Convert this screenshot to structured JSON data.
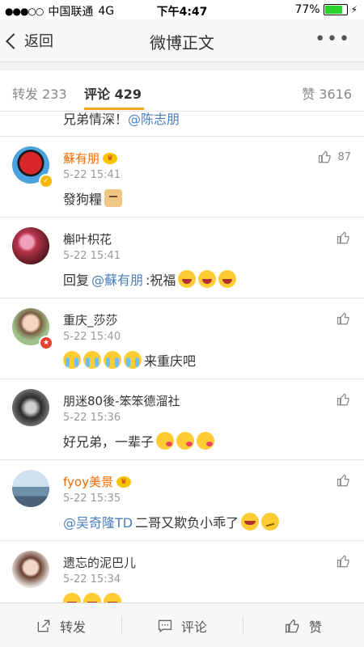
{
  "status": {
    "carrier": "中国联通",
    "network": "4G",
    "time": "下午4:47",
    "battery": "77%",
    "battery_level": 0.77
  },
  "nav": {
    "back_label": "返回",
    "title": "微博正文",
    "more_label": "•••"
  },
  "tabs": {
    "repost": "转发 233",
    "comment": "评论 429",
    "like": "赞 3616"
  },
  "partial_comment": {
    "text": "兄弟情深！",
    "mention": "@陈志朋"
  },
  "comments": [
    {
      "name": "蘇有朋",
      "time": "5-22 15:41",
      "text_before": "發狗糧",
      "mention": "",
      "text_after": "",
      "emojis": [
        "doge"
      ],
      "likes": "87"
    },
    {
      "name": "槲叶枳花",
      "time": "5-22 15:41",
      "text_before": "回复",
      "mention": "@蘇有朋",
      "text_after": ":祝福",
      "emojis": [
        "laugh",
        "laugh",
        "laugh"
      ],
      "likes": ""
    },
    {
      "name": "重庆_莎莎",
      "time": "5-22 15:40",
      "text_before": "",
      "mention": "",
      "text_after": "来重庆吧",
      "emojis": [
        "cry",
        "cry",
        "cry",
        "cry"
      ],
      "likes": ""
    },
    {
      "name": "朋迷80後-笨笨德溜社",
      "time": "5-22 15:36",
      "text_before": "好兄弟，一辈子",
      "mention": "",
      "text_after": "",
      "emojis": [
        "kiss",
        "kiss",
        "kiss"
      ],
      "likes": ""
    },
    {
      "name": "fyoy美景",
      "time": "5-22 15:35",
      "text_before": "",
      "mention": "@吴奇隆TD",
      "text_after": " 二哥又欺负小乖了",
      "emojis": [
        "tear",
        "think"
      ],
      "likes": ""
    },
    {
      "name": "遗忘的泥巴儿",
      "time": "5-22 15:34",
      "text_before": "",
      "mention": "",
      "text_after": "",
      "emojis": [
        "laugh",
        "laugh",
        "laugh"
      ],
      "likes": ""
    }
  ],
  "bottom": {
    "repost": "转发",
    "comment": "评论",
    "like": "赞"
  },
  "colors": {
    "accent": "#f5a623",
    "mention": "#4a7fc0",
    "vip_name": "#f36b00"
  }
}
